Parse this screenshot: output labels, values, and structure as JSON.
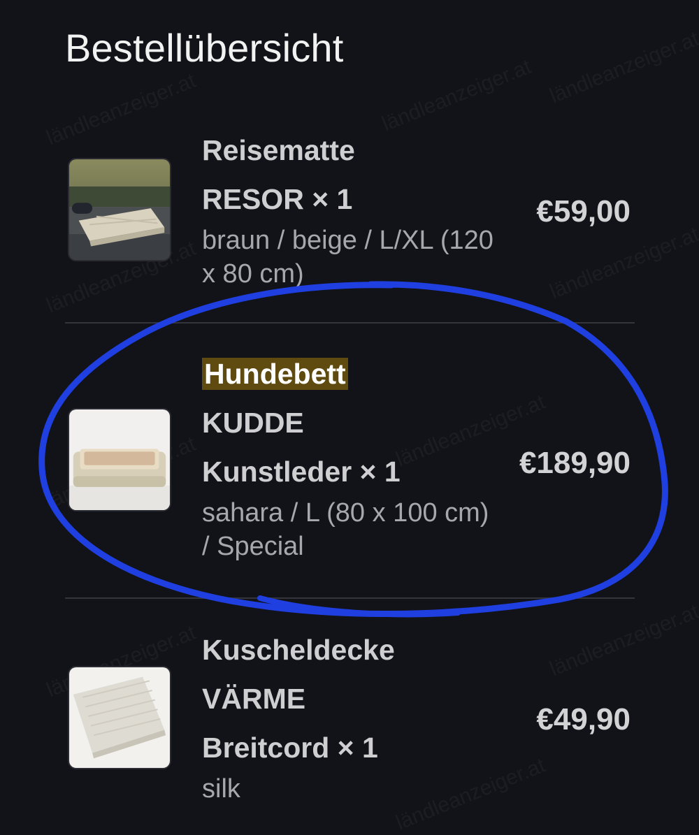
{
  "header": {
    "title": "Bestellübersicht"
  },
  "items": [
    {
      "line1": "Reisematte",
      "line2": "RESOR × 1",
      "variant": "braun / beige / L/XL (120 x 80 cm)",
      "price": "€59,00"
    },
    {
      "line1": "Hundebett",
      "line2": "KUDDE",
      "line3": "Kunstleder × 1",
      "variant": "sahara / L (80 x 100 cm) / Special",
      "price": "€189,90"
    },
    {
      "line1": "Kuscheldecke",
      "line2": "VÄRME",
      "line3": "Breitcord × 1",
      "variant": "silk",
      "price": "€49,90"
    }
  ],
  "watermark": {
    "text": "ländleanzeiger.at"
  },
  "colors": {
    "background": "#121318",
    "highlight": "#5f4a10",
    "annotation": "#1f3fe0"
  }
}
